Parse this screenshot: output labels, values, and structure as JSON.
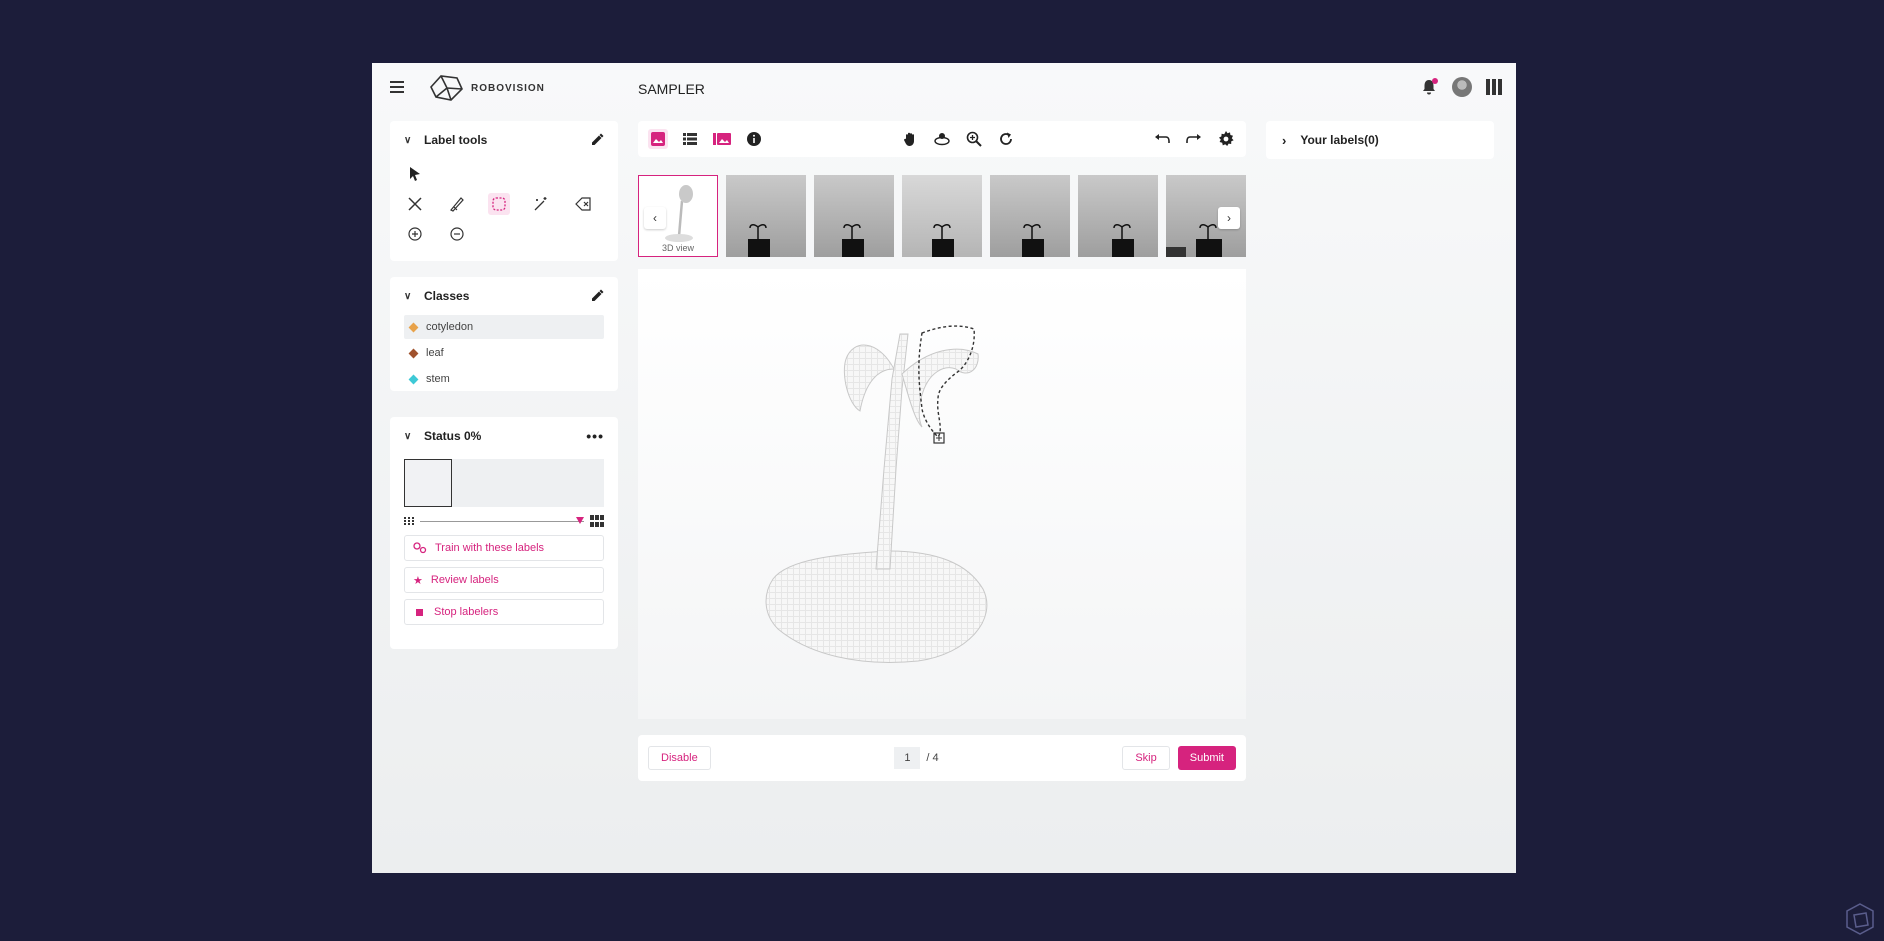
{
  "app": {
    "logo_text": "ROBOVISION",
    "page_title": "SAMPLER"
  },
  "label_tools": {
    "title": "Label tools"
  },
  "classes": {
    "title": "Classes",
    "items": [
      {
        "label": "cotyledon",
        "color": "#e8a24a"
      },
      {
        "label": "leaf",
        "color": "#a0522d"
      },
      {
        "label": "stem",
        "color": "#3ec9d6"
      }
    ]
  },
  "status": {
    "title": "Status 0%",
    "progress": 0,
    "buttons": {
      "train": "Train with these labels",
      "review": "Review labels",
      "stop": "Stop labelers"
    }
  },
  "thumbnails": {
    "first_label": "3D view",
    "count": 7
  },
  "bottom": {
    "disable": "Disable",
    "page_current": "1",
    "page_total": "/ 4",
    "skip": "Skip",
    "submit": "Submit"
  },
  "labels_panel": {
    "title": "Your labels(0)"
  },
  "colors": {
    "accent": "#d6237e",
    "background": "#1c1d3a"
  }
}
